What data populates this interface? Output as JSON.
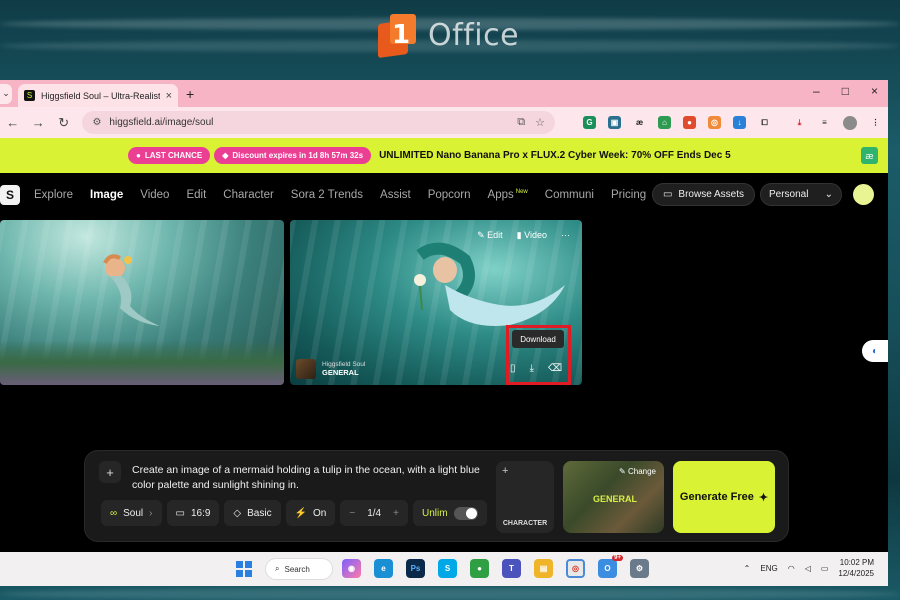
{
  "desktop": {
    "logo_text": "Office"
  },
  "browser": {
    "tab_title": "Higgsfield Soul – Ultra-Realisti",
    "url": "higgsfield.ai/image/soul",
    "window_controls": [
      "–",
      "□",
      "×"
    ]
  },
  "promo": {
    "pill1": "LAST CHANCE",
    "pill2": "Discount expires in 1d 8h 57m 32s",
    "text_prefix": "UNLIMITED Nano Banana Pro x FLUX.2 Cyber Week: ",
    "text_highlight": "70% OFF Ends",
    "text_suffix": " Dec 5"
  },
  "nav": {
    "items": [
      "Explore",
      "Image",
      "Video",
      "Edit",
      "Character",
      "Sora 2 Trends",
      "Assist",
      "Popcorn",
      "Apps",
      "Communi",
      "Pricing"
    ],
    "new_badge": "New",
    "browse_assets": "Browse Assets",
    "personal": "Personal"
  },
  "gallery": {
    "edit_label": "Edit",
    "video_label": "Video",
    "more_label": "···",
    "meta_source": "Higgsfield Soul",
    "meta_style": "GENERAL",
    "tooltip": "Download"
  },
  "prompt": {
    "text": "Create an image of a mermaid holding a tulip in the ocean, with a light blue color palette and sunlight shining in.",
    "soul": "Soul",
    "ratio": "16:9",
    "quality": "Basic",
    "enhance": "On",
    "count": "1/4",
    "unlim": "Unlim",
    "character": "CHARACTER",
    "change": "Change",
    "general": "GENERAL",
    "generate": "Generate Free"
  },
  "taskbar": {
    "search": "Search",
    "lang": "ENG",
    "time": "10:02 PM",
    "date": "12/4/2025",
    "notif_count": "9+"
  },
  "colors": {
    "accent": "#d9f233",
    "promo_pill": "#ea3f93",
    "tab_bar": "#f7b4c4",
    "highlight_box": "#e11b24"
  }
}
